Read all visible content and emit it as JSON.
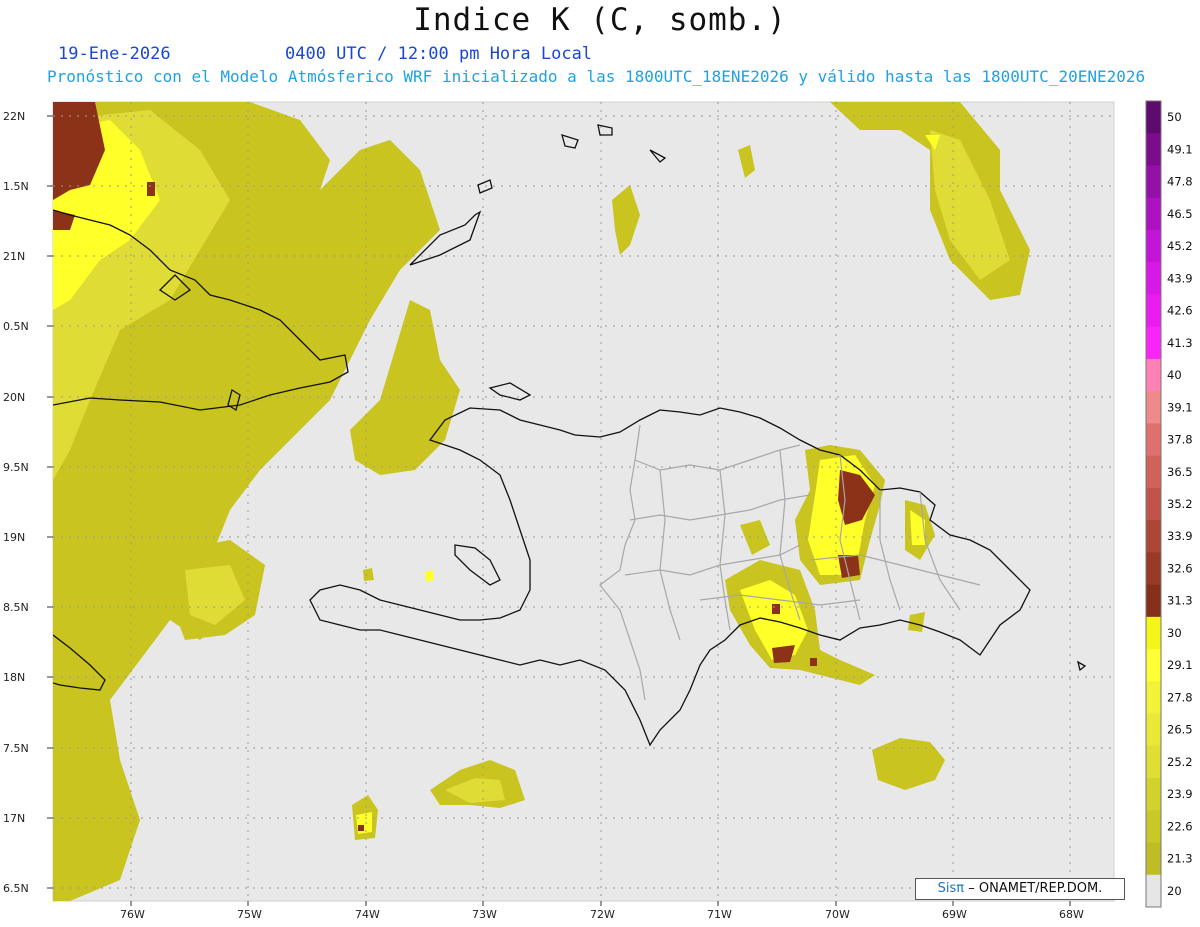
{
  "header": {
    "title": "Indice K (C, somb.)",
    "date": "19-Ene-2026",
    "time": "0400 UTC / 12:00 pm Hora Local",
    "subtitle": "Pronóstico con el Modelo Atmósferico WRF inicializado a las 1800UTC_18ENE2026 y válido hasta las  1800UTC_20ENE2026"
  },
  "map": {
    "lat_labels": [
      "22N",
      "1.5N",
      "21N",
      "0.5N",
      "20N",
      "9.5N",
      "19N",
      "8.5N",
      "18N",
      "7.5N",
      "17N",
      "6.5N"
    ],
    "lon_labels": [
      "76W",
      "75W",
      "74W",
      "73W",
      "72W",
      "71W",
      "70W",
      "69W",
      "68W"
    ],
    "colors": {
      "ocean": "#e8e8e8",
      "k20": "#c9c41f",
      "k26": "#e6e63a",
      "k29": "#ffff2a",
      "k30": "#8b3218"
    }
  },
  "colorbar": {
    "labels": [
      "50",
      "49.1",
      "47.8",
      "46.5",
      "45.2",
      "43.9",
      "42.6",
      "41.3",
      "40",
      "39.1",
      "37.8",
      "36.5",
      "35.2",
      "33.9",
      "32.6",
      "31.3",
      "30",
      "29.1",
      "27.8",
      "26.5",
      "25.2",
      "23.9",
      "22.6",
      "21.3",
      "20"
    ],
    "colors": [
      "#5e0a6e",
      "#7b0c8c",
      "#9410a8",
      "#ad12c2",
      "#c414d8",
      "#d818e6",
      "#ea1cf0",
      "#f824f8",
      "#ff80b4",
      "#ef8a8a",
      "#e07070",
      "#d0625a",
      "#c05448",
      "#ac4636",
      "#983a28",
      "#86301a",
      "#f6f51a",
      "#ffff36",
      "#f2f238",
      "#e8e838",
      "#dede34",
      "#d2d22e",
      "#c8c828",
      "#bebe24",
      "#e6e6e6"
    ]
  },
  "credit": {
    "brand": "Sisπ",
    "text": "– ONAMET/REP.DOM."
  }
}
